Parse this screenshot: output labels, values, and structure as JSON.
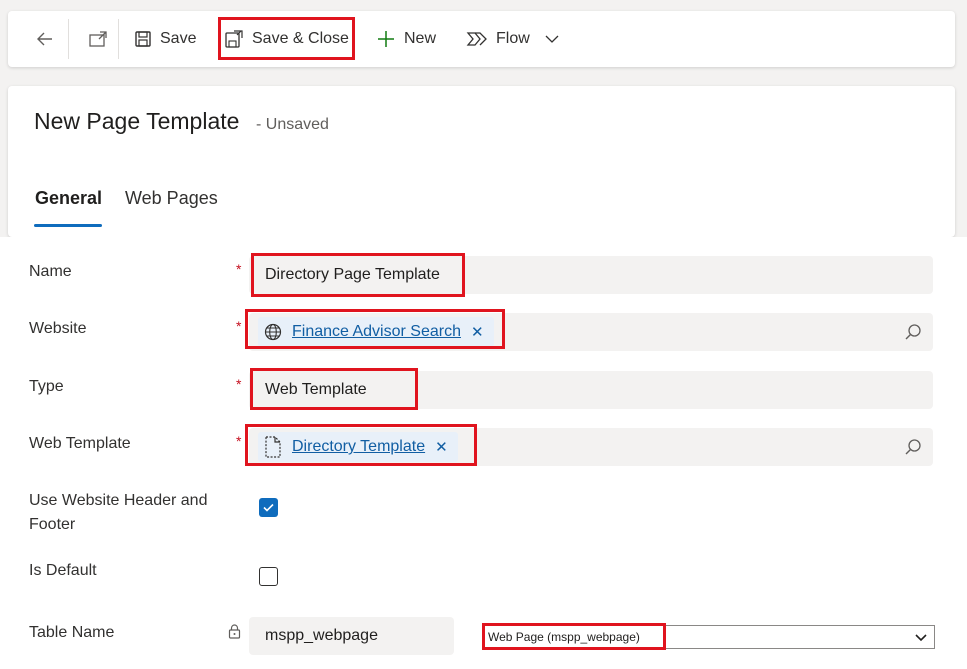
{
  "toolbar": {
    "save_label": "Save",
    "save_close_label": "Save & Close",
    "new_label": "New",
    "flow_label": "Flow"
  },
  "header": {
    "title": "New Page Template",
    "status": "- Unsaved",
    "tabs": [
      {
        "label": "General",
        "active": true
      },
      {
        "label": "Web Pages",
        "active": false
      }
    ]
  },
  "form": {
    "name": {
      "label": "Name",
      "value": "Directory Page Template",
      "required": true
    },
    "website": {
      "label": "Website",
      "value": "Finance Advisor Search",
      "icon": "globe-icon",
      "required": true
    },
    "type": {
      "label": "Type",
      "value": "Web Template",
      "required": true
    },
    "web_template": {
      "label": "Web Template",
      "value": "Directory Template",
      "icon": "document-icon",
      "required": true
    },
    "use_header_footer": {
      "label_line1": "Use Website Header and",
      "label_line2": "Footer",
      "checked": true
    },
    "is_default": {
      "label": "Is Default",
      "checked": false
    },
    "table_name": {
      "label": "Table Name",
      "value": "mspp_webpage",
      "select_value": "Web Page (mspp_webpage)",
      "locked": true
    }
  },
  "colors": {
    "accent": "#0f6cbd",
    "required": "#c50f1f",
    "highlight": "#e0141e",
    "link": "#115ea3"
  }
}
